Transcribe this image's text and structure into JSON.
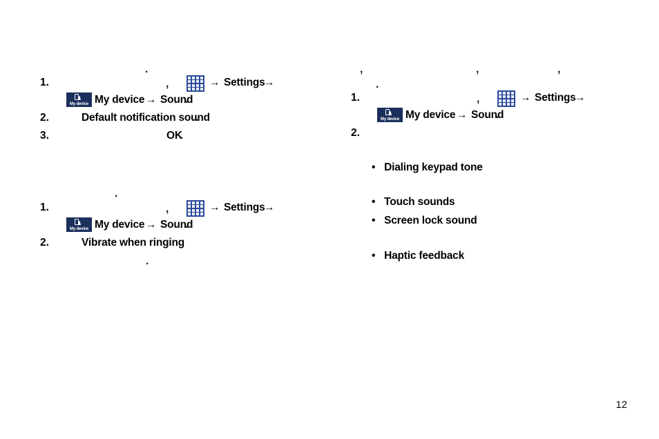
{
  "document": {
    "page_number": "12",
    "colors": {
      "apps_icon_blue": "#2a4b9b",
      "mydevice_icon_navy": "#1b2f5c",
      "text": "#000000"
    }
  },
  "icons": {
    "apps_icon_name": "apps-grid-icon",
    "mydevice_icon_name": "my-device-tab-icon",
    "mydevice_label": "My device",
    "arrow": "→",
    "bullet": "•"
  },
  "left_column": {
    "section_one": {
      "intro_punct": ".",
      "steps": [
        {
          "number": "1.",
          "comma": ",",
          "settings_label": "Settings",
          "arrow_a": "→",
          "arrow_b": "→",
          "arrow_c": "→",
          "my_device_label": "My device",
          "sound_label": "Sound",
          "period": "."
        },
        {
          "number": "2.",
          "bold_text": "Default notification sound",
          "period": "."
        },
        {
          "number": "3.",
          "bold_text": "OK",
          "period": "."
        }
      ]
    },
    "section_two": {
      "intro_punct": ".",
      "steps": [
        {
          "number": "1.",
          "comma": ",",
          "settings_label": "Settings",
          "arrow_a": "→",
          "arrow_b": "→",
          "arrow_c": "→",
          "my_device_label": "My device",
          "sound_label": "Sound",
          "period": "."
        },
        {
          "number": "2.",
          "bold_text": "Vibrate when ringing",
          "trailing_period": "."
        }
      ]
    }
  },
  "right_column": {
    "intro": {
      "comma_one": ",",
      "comma_two": ",",
      "comma_three": ",",
      "period": "."
    },
    "steps": [
      {
        "number": "1.",
        "comma": ",",
        "settings_label": "Settings",
        "arrow_a": "→",
        "arrow_b": "→",
        "arrow_c": "→",
        "my_device_label": "My device",
        "sound_label": "Sound",
        "period": "."
      },
      {
        "number": "2."
      }
    ],
    "bullets": [
      {
        "bullet": "•",
        "label": "Dialing keypad tone"
      },
      {
        "bullet": "•",
        "label": "Touch sounds"
      },
      {
        "bullet": "•",
        "label": "Screen lock sound"
      },
      {
        "bullet": "•",
        "label": "Haptic feedback"
      }
    ]
  }
}
